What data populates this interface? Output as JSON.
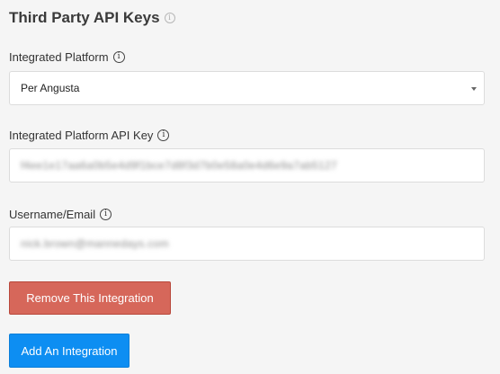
{
  "section": {
    "title": "Third Party API Keys",
    "info_glyph": "i"
  },
  "platform": {
    "label": "Integrated Platform",
    "info_glyph": "i",
    "selected_value": "Per Angusta"
  },
  "api_key": {
    "label": "Integrated Platform API Key",
    "info_glyph": "i",
    "value_redacted": "f4ee1e17aa6a0b5e4d9f1bce7d8f3d7b0e58a0e4d6e9a7ab5127"
  },
  "username": {
    "label": "Username/Email",
    "info_glyph": "i",
    "value_redacted": "nick.brown@mannedays.com"
  },
  "buttons": {
    "remove_label": "Remove This Integration",
    "add_label": "Add An Integration"
  },
  "colors": {
    "danger": "#d6675a",
    "primary": "#0d8ef2",
    "background": "#f5f5f5"
  }
}
